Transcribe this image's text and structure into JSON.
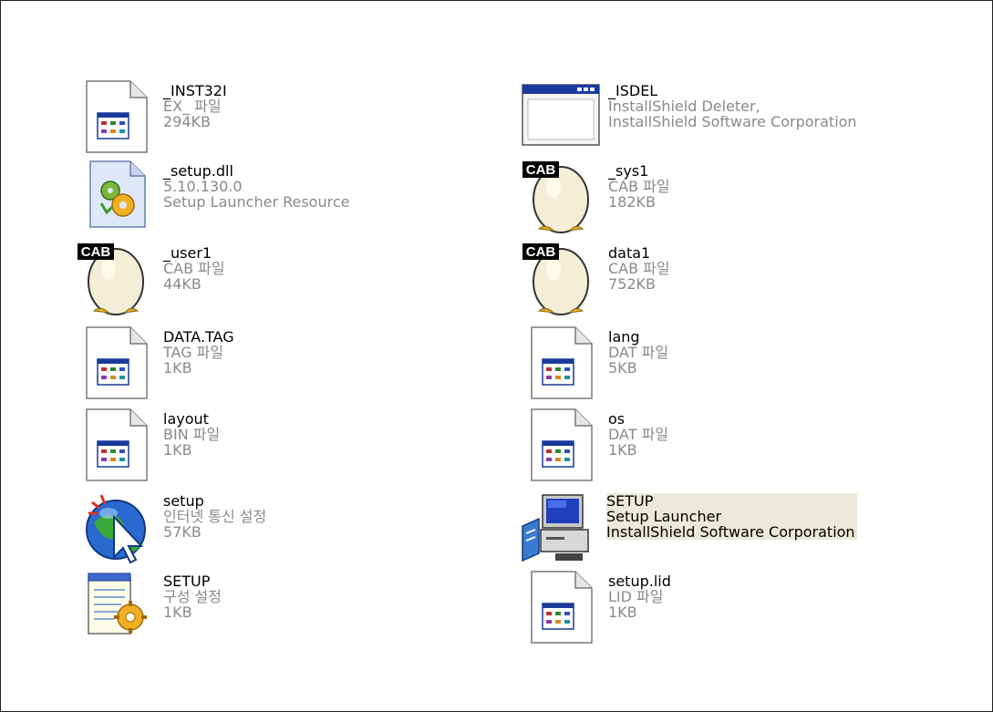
{
  "files": [
    {
      "name": "_INST32I",
      "line2": "EX_ 파일",
      "line3": "294KB",
      "icon": "generic-file-icon"
    },
    {
      "name": "_ISDEL",
      "line2": "InstallShield Deleter,",
      "line3": "InstallShield Software Corporation",
      "icon": "application-window-icon"
    },
    {
      "name": "_setup.dll",
      "line2": "5.10.130.0",
      "line3": "Setup Launcher Resource",
      "icon": "dll-gear-icon"
    },
    {
      "name": "_sys1",
      "line2": "CAB 파일",
      "line3": "182KB",
      "icon": "cab-archive-icon",
      "badge": "CAB"
    },
    {
      "name": "_user1",
      "line2": "CAB 파일",
      "line3": "44KB",
      "icon": "cab-archive-icon",
      "badge": "CAB"
    },
    {
      "name": "data1",
      "line2": "CAB 파일",
      "line3": "752KB",
      "icon": "cab-archive-icon",
      "badge": "CAB"
    },
    {
      "name": "DATA.TAG",
      "line2": "TAG 파일",
      "line3": "1KB",
      "icon": "generic-file-icon"
    },
    {
      "name": "lang",
      "line2": "DAT 파일",
      "line3": "5KB",
      "icon": "generic-file-icon"
    },
    {
      "name": "layout",
      "line2": "BIN 파일",
      "line3": "1KB",
      "icon": "generic-file-icon"
    },
    {
      "name": "os",
      "line2": "DAT 파일",
      "line3": "1KB",
      "icon": "generic-file-icon"
    },
    {
      "name": "setup",
      "line2": "인터넷 통신 설정",
      "line3": "57KB",
      "icon": "internet-settings-globe-icon"
    },
    {
      "name": "SETUP",
      "line2": "Setup Launcher",
      "line3": "InstallShield Software Corporation",
      "icon": "setup-computer-icon",
      "selected": true
    },
    {
      "name": "SETUP",
      "line2": "구성 설정",
      "line3": "1KB",
      "icon": "config-notepad-gear-icon"
    },
    {
      "name": "setup.lid",
      "line2": "LID 파일",
      "line3": "1KB",
      "icon": "generic-file-icon"
    }
  ],
  "colors": {
    "selection": "#ece9d8",
    "subtext": "#8a8a8a",
    "cab_badge": "#000000"
  }
}
